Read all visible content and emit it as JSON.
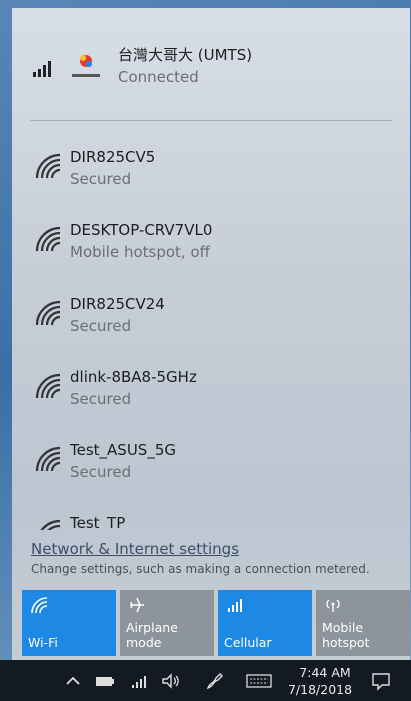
{
  "cellular": {
    "name": "台灣大哥大 (UMTS)",
    "status": "Connected",
    "icon": "cellular-signal-icon",
    "logo": "carrier-logo"
  },
  "networks": [
    {
      "name": "DIR825CV5",
      "status": "Secured",
      "icon": "wifi-icon"
    },
    {
      "name": "DESKTOP-CRV7VL0",
      "status": "Mobile hotspot, off",
      "icon": "wifi-icon"
    },
    {
      "name": "DIR825CV24",
      "status": "Secured",
      "icon": "wifi-icon"
    },
    {
      "name": "dlink-8BA8-5GHz",
      "status": "Secured",
      "icon": "wifi-icon"
    },
    {
      "name": "Test_ASUS_5G",
      "status": "Secured",
      "icon": "wifi-icon"
    },
    {
      "name": "Test_TP",
      "status": "",
      "icon": "wifi-icon"
    }
  ],
  "settings": {
    "link": "Network & Internet settings",
    "description": "Change settings, such as making a connection metered."
  },
  "tiles": [
    {
      "label": "Wi-Fi",
      "active": true,
      "icon": "wifi-icon"
    },
    {
      "label": "Airplane mode",
      "active": false,
      "icon": "airplane-icon"
    },
    {
      "label": "Cellular",
      "active": true,
      "icon": "cellular-signal-icon"
    },
    {
      "label": "Mobile hotspot",
      "active": false,
      "icon": "hotspot-icon"
    }
  ],
  "colors": {
    "tile_active": "#1e88e5",
    "tile_inactive": "#8d949c",
    "accent": "#0078d7"
  },
  "taskbar": {
    "time": "7:44 AM",
    "date": "7/18/2018",
    "icons": [
      "chevron-up-icon",
      "battery-icon",
      "cellular-signal-icon",
      "volume-icon",
      "pen-icon",
      "keyboard-icon",
      "action-center-icon"
    ]
  }
}
